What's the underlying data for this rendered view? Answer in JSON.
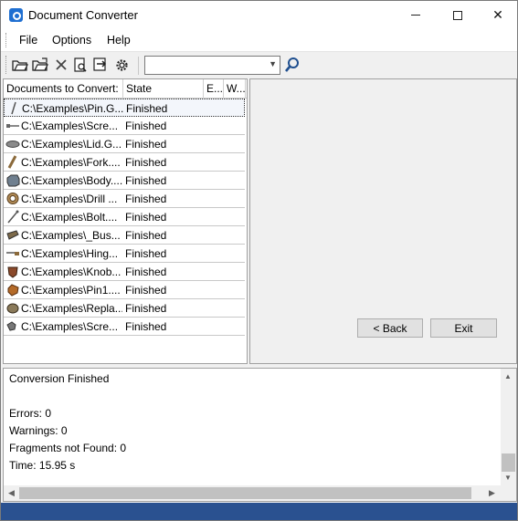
{
  "window": {
    "title": "Document Converter",
    "controls": {
      "minimize": "—",
      "maximize": "",
      "close": "✕"
    }
  },
  "menu": [
    "File",
    "Options",
    "Help"
  ],
  "toolbar": {
    "icons": [
      "open-folder-icon",
      "open-folders-icon",
      "delete-icon",
      "print-preview-icon",
      "export-icon",
      "settings-gear-icon"
    ],
    "search_value": "",
    "search_icon": "magnifier-icon"
  },
  "list": {
    "columns": [
      "Documents to Convert:",
      "State",
      "E...",
      "W..."
    ],
    "rows": [
      {
        "icon": "pin-part-icon",
        "path": "C:\\Examples\\Pin.G...",
        "state": "Finished",
        "selected": true
      },
      {
        "icon": "screw-part-icon",
        "path": "C:\\Examples\\Scre...",
        "state": "Finished"
      },
      {
        "icon": "lid-part-icon",
        "path": "C:\\Examples\\Lid.G...",
        "state": "Finished"
      },
      {
        "icon": "fork-part-icon",
        "path": "C:\\Examples\\Fork....",
        "state": "Finished"
      },
      {
        "icon": "body-part-icon",
        "path": "C:\\Examples\\Body....",
        "state": "Finished"
      },
      {
        "icon": "drill-part-icon",
        "path": "C:\\Examples\\Drill ...",
        "state": "Finished"
      },
      {
        "icon": "bolt-part-icon",
        "path": "C:\\Examples\\Bolt....",
        "state": "Finished"
      },
      {
        "icon": "bus-part-icon",
        "path": "C:\\Examples\\_Bus...",
        "state": "Finished"
      },
      {
        "icon": "hinge-part-icon",
        "path": "C:\\Examples\\Hing...",
        "state": "Finished"
      },
      {
        "icon": "knob-part-icon",
        "path": "C:\\Examples\\Knob...",
        "state": "Finished"
      },
      {
        "icon": "pin1-part-icon",
        "path": "C:\\Examples\\Pin1....",
        "state": "Finished"
      },
      {
        "icon": "replace-part-icon",
        "path": "C:\\Examples\\Repla...",
        "state": "Finished"
      },
      {
        "icon": "screw2-part-icon",
        "path": "C:\\Examples\\Scre...",
        "state": "Finished"
      }
    ]
  },
  "buttons": {
    "back": "< Back",
    "exit": "Exit"
  },
  "log": {
    "lines": [
      "Conversion Finished",
      "",
      "Errors: 0",
      "Warnings: 0",
      "Fragments not Found: 0",
      "Time: 15.95 s"
    ]
  },
  "colors": {
    "accent": "#2a5190",
    "icon_brown": "#8b5a2b",
    "icon_gray": "#7a7a7a"
  }
}
